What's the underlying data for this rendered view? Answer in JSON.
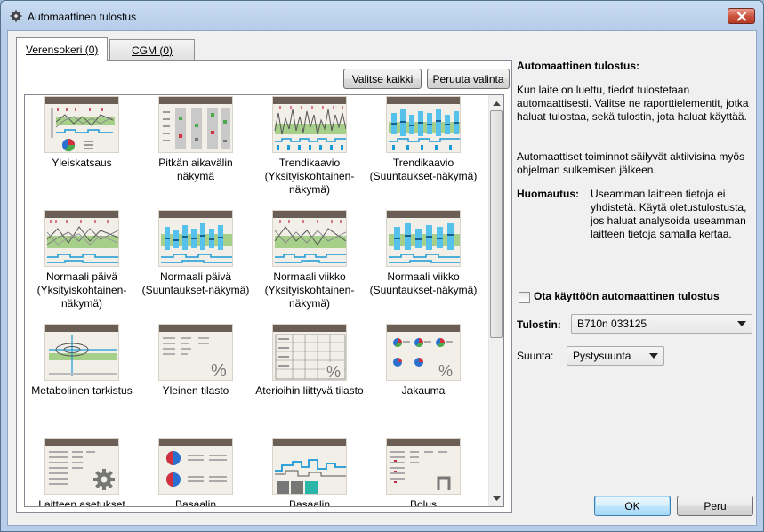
{
  "window": {
    "title": "Automaattinen tulostus"
  },
  "tabs": [
    {
      "label": "Verensokeri (0)",
      "active": true
    },
    {
      "label": "CGM (0)",
      "active": false
    }
  ],
  "toolbar": {
    "select_all": "Valitse kaikki",
    "cancel_selection": "Peruuta valinta"
  },
  "reports": [
    {
      "label": "Yleiskatsaus",
      "icon": "overview-report-icon"
    },
    {
      "label": "Pitkän aikavälin näkymä",
      "icon": "long-term-report-icon"
    },
    {
      "label": "Trendikaavio (Yksityiskohtainen-näkymä)",
      "icon": "trend-detail-report-icon"
    },
    {
      "label": "Trendikaavio (Suuntaukset-näkymä)",
      "icon": "trend-summary-report-icon"
    },
    {
      "label": "Normaali päivä (Yksityiskohtainen-näkymä)",
      "icon": "standard-day-detail-report-icon"
    },
    {
      "label": "Normaali päivä (Suuntaukset-näkymä)",
      "icon": "standard-day-summary-report-icon"
    },
    {
      "label": "Normaali viikko (Yksityiskohtainen-näkymä)",
      "icon": "standard-week-detail-report-icon"
    },
    {
      "label": "Normaali viikko (Suuntaukset-näkymä)",
      "icon": "standard-week-summary-report-icon"
    },
    {
      "label": "Metabolinen tarkistus",
      "icon": "metabolic-report-icon"
    },
    {
      "label": "Yleinen tilasto",
      "icon": "general-stats-report-icon"
    },
    {
      "label": "Aterioihin liittyvä tilasto",
      "icon": "meal-stats-report-icon"
    },
    {
      "label": "Jakauma",
      "icon": "distribution-report-icon"
    },
    {
      "label": "Laitteen asetukset",
      "icon": "device-settings-report-icon"
    },
    {
      "label": "Basaalin",
      "icon": "basal-pie-report-icon"
    },
    {
      "label": "Basaalin",
      "icon": "basal-chart-report-icon"
    },
    {
      "label": "Bolus",
      "icon": "bolus-report-icon"
    }
  ],
  "info": {
    "title": "Automaattinen tulostus:",
    "p1": "Kun laite on luettu, tiedot tulostetaan automaattisesti. Valitse ne raporttielementit, jotka haluat tulostaa, sekä tulostin, jota haluat käyttää.",
    "p2": "Automaattiset toiminnot säilyvät aktiivisina myös ohjelman sulkemisen jälkeen.",
    "note_label": "Huomautus:",
    "note_text": "Useamman laitteen tietoja ei yhdistetä. Käytä oletustulostusta, jos haluat analysoida useamman laitteen tietoja samalla kertaa."
  },
  "settings": {
    "enable_label": "Ota käyttöön automaattinen tulostus",
    "enable_checked": false,
    "printer_label": "Tulostin:",
    "printer_value": "B710n 033125",
    "orientation_label": "Suunta:",
    "orientation_value": "Pystysuunta"
  },
  "buttons": {
    "ok": "OK",
    "cancel": "Peru"
  },
  "colors": {
    "thumb_header": "#6b5e54",
    "accent_blue": "#1a9ad6",
    "chart_green": "#a6d08a"
  }
}
